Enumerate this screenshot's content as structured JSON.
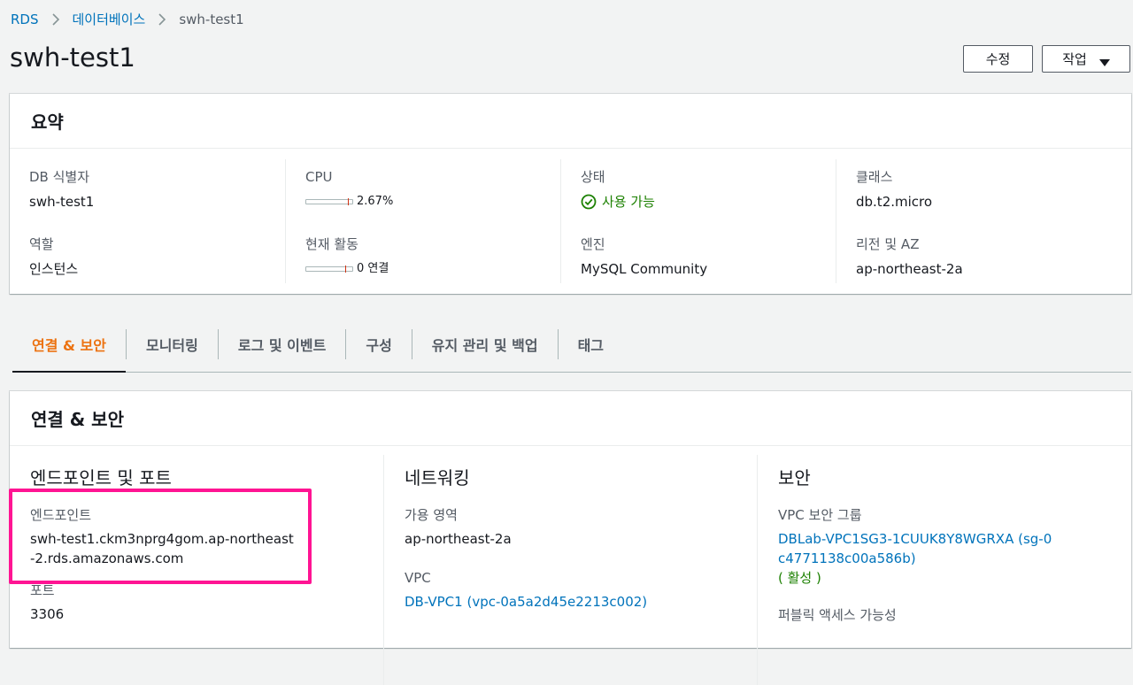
{
  "breadcrumb": {
    "items": [
      "RDS",
      "데이터베이스",
      "swh-test1"
    ]
  },
  "page": {
    "title": "swh-test1",
    "edit_label": "수정",
    "actions_label": "작업"
  },
  "summary": {
    "title": "요약",
    "db_id_label": "DB 식별자",
    "db_id_value": "swh-test1",
    "role_label": "역할",
    "role_value": "인스턴스",
    "cpu_label": "CPU",
    "cpu_value": "2.67%",
    "cpu_percent": 2.67,
    "activity_label": "현재 활동",
    "activity_value": "0 연결",
    "activity_count": 0,
    "status_label": "상태",
    "status_value": "사용 가능",
    "engine_label": "엔진",
    "engine_value": "MySQL Community",
    "class_label": "클래스",
    "class_value": "db.t2.micro",
    "region_label": "리전 및 AZ",
    "region_value": "ap-northeast-2a"
  },
  "tabs": [
    {
      "label": "연결 & 보안",
      "active": true
    },
    {
      "label": "모니터링",
      "active": false
    },
    {
      "label": "로그 및 이벤트",
      "active": false
    },
    {
      "label": "구성",
      "active": false
    },
    {
      "label": "유지 관리 및 백업",
      "active": false
    },
    {
      "label": "태그",
      "active": false
    }
  ],
  "connectivity": {
    "title": "연결 & 보안",
    "endpoint_section": "엔드포인트 및 포트",
    "endpoint_label": "엔드포인트",
    "endpoint_value": "swh-test1.ckm3nprg4gom.ap-northeast-2.rds.amazonaws.com",
    "port_label": "포트",
    "port_value": "3306",
    "network_section": "네트워킹",
    "az_label": "가용 영역",
    "az_value": "ap-northeast-2a",
    "vpc_label": "VPC",
    "vpc_value": "DB-VPC1 (vpc-0a5a2d45e2213c002)",
    "security_section": "보안",
    "sg_label": "VPC 보안 그룹",
    "sg_value": "DBLab-VPC1SG3-1CUUK8Y8WGRXA (sg-0c4771138c00a586b)",
    "sg_status": "( 활성 )",
    "public_label": "퍼블릭 액세스 가능성"
  },
  "colors": {
    "link": "#0073bb",
    "active_tab": "#ec7211",
    "status_ok": "#1d8102",
    "highlight": "#ff1493"
  },
  "icons": {
    "breadcrumb_separator": "chevron-right-icon",
    "actions_caret": "caret-down-icon",
    "status": "check-circle-icon"
  }
}
